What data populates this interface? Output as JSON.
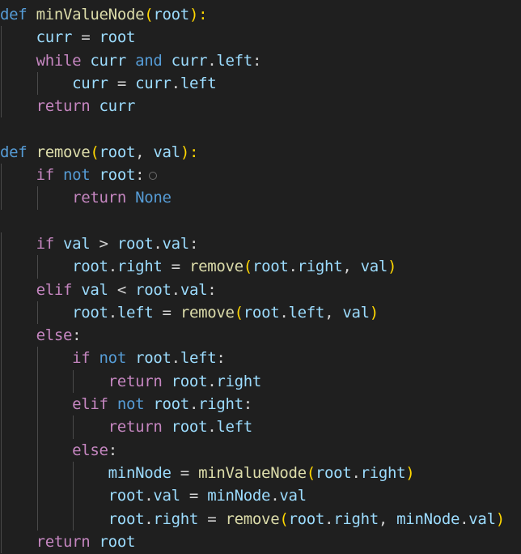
{
  "editor": {
    "language": "python",
    "theme": {
      "background": "#1f1f1f"
    },
    "lines": [
      [
        {
          "t": "def",
          "c": "kw"
        },
        {
          "t": " ",
          "c": "op"
        },
        {
          "t": "minValueNode",
          "c": "fn"
        },
        {
          "t": "(",
          "c": "paren"
        },
        {
          "t": "root",
          "c": "var"
        },
        {
          "t": "):",
          "c": "paren"
        }
      ],
      [
        {
          "t": "    "
        },
        {
          "t": "curr",
          "c": "var"
        },
        {
          "t": " = ",
          "c": "op"
        },
        {
          "t": "root",
          "c": "var"
        }
      ],
      [
        {
          "t": "    "
        },
        {
          "t": "while",
          "c": "ctl"
        },
        {
          "t": " ",
          "c": "op"
        },
        {
          "t": "curr",
          "c": "var"
        },
        {
          "t": " ",
          "c": "op"
        },
        {
          "t": "and",
          "c": "kw"
        },
        {
          "t": " ",
          "c": "op"
        },
        {
          "t": "curr",
          "c": "var"
        },
        {
          "t": ".",
          "c": "op"
        },
        {
          "t": "left",
          "c": "var"
        },
        {
          "t": ":",
          "c": "op"
        }
      ],
      [
        {
          "t": "        "
        },
        {
          "t": "curr",
          "c": "var"
        },
        {
          "t": " = ",
          "c": "op"
        },
        {
          "t": "curr",
          "c": "var"
        },
        {
          "t": ".",
          "c": "op"
        },
        {
          "t": "left",
          "c": "var"
        }
      ],
      [
        {
          "t": "    "
        },
        {
          "t": "return",
          "c": "ctl"
        },
        {
          "t": " ",
          "c": "op"
        },
        {
          "t": "curr",
          "c": "var"
        }
      ],
      [],
      [
        {
          "t": "def",
          "c": "kw"
        },
        {
          "t": " ",
          "c": "op"
        },
        {
          "t": "remove",
          "c": "fn"
        },
        {
          "t": "(",
          "c": "paren"
        },
        {
          "t": "root",
          "c": "var"
        },
        {
          "t": ", ",
          "c": "op"
        },
        {
          "t": "val",
          "c": "var"
        },
        {
          "t": "):",
          "c": "paren"
        }
      ],
      [
        {
          "t": "    "
        },
        {
          "t": "if",
          "c": "ctl"
        },
        {
          "t": " ",
          "c": "op"
        },
        {
          "t": "not",
          "c": "kw"
        },
        {
          "t": " ",
          "c": "op"
        },
        {
          "t": "root",
          "c": "var"
        },
        {
          "t": ":",
          "c": "op"
        },
        {
          "hint": "inlay-hint-dot"
        }
      ],
      [
        {
          "t": "        "
        },
        {
          "t": "return",
          "c": "ctl"
        },
        {
          "t": " ",
          "c": "op"
        },
        {
          "t": "None",
          "c": "const"
        }
      ],
      [],
      [
        {
          "t": "    "
        },
        {
          "t": "if",
          "c": "ctl"
        },
        {
          "t": " ",
          "c": "op"
        },
        {
          "t": "val",
          "c": "var"
        },
        {
          "t": " > ",
          "c": "op"
        },
        {
          "t": "root",
          "c": "var"
        },
        {
          "t": ".",
          "c": "op"
        },
        {
          "t": "val",
          "c": "var"
        },
        {
          "t": ":",
          "c": "op"
        }
      ],
      [
        {
          "t": "        "
        },
        {
          "t": "root",
          "c": "var"
        },
        {
          "t": ".",
          "c": "op"
        },
        {
          "t": "right",
          "c": "var"
        },
        {
          "t": " = ",
          "c": "op"
        },
        {
          "t": "remove",
          "c": "fn"
        },
        {
          "t": "(",
          "c": "paren"
        },
        {
          "t": "root",
          "c": "var"
        },
        {
          "t": ".",
          "c": "op"
        },
        {
          "t": "right",
          "c": "var"
        },
        {
          "t": ", ",
          "c": "op"
        },
        {
          "t": "val",
          "c": "var"
        },
        {
          "t": ")",
          "c": "paren"
        }
      ],
      [
        {
          "t": "    "
        },
        {
          "t": "elif",
          "c": "ctl"
        },
        {
          "t": " ",
          "c": "op"
        },
        {
          "t": "val",
          "c": "var"
        },
        {
          "t": " < ",
          "c": "op"
        },
        {
          "t": "root",
          "c": "var"
        },
        {
          "t": ".",
          "c": "op"
        },
        {
          "t": "val",
          "c": "var"
        },
        {
          "t": ":",
          "c": "op"
        }
      ],
      [
        {
          "t": "        "
        },
        {
          "t": "root",
          "c": "var"
        },
        {
          "t": ".",
          "c": "op"
        },
        {
          "t": "left",
          "c": "var"
        },
        {
          "t": " = ",
          "c": "op"
        },
        {
          "t": "remove",
          "c": "fn"
        },
        {
          "t": "(",
          "c": "paren"
        },
        {
          "t": "root",
          "c": "var"
        },
        {
          "t": ".",
          "c": "op"
        },
        {
          "t": "left",
          "c": "var"
        },
        {
          "t": ", ",
          "c": "op"
        },
        {
          "t": "val",
          "c": "var"
        },
        {
          "t": ")",
          "c": "paren"
        }
      ],
      [
        {
          "t": "    "
        },
        {
          "t": "else",
          "c": "ctl"
        },
        {
          "t": ":",
          "c": "op"
        }
      ],
      [
        {
          "t": "        "
        },
        {
          "t": "if",
          "c": "ctl"
        },
        {
          "t": " ",
          "c": "op"
        },
        {
          "t": "not",
          "c": "kw"
        },
        {
          "t": " ",
          "c": "op"
        },
        {
          "t": "root",
          "c": "var"
        },
        {
          "t": ".",
          "c": "op"
        },
        {
          "t": "left",
          "c": "var"
        },
        {
          "t": ":",
          "c": "op"
        }
      ],
      [
        {
          "t": "            "
        },
        {
          "t": "return",
          "c": "ctl"
        },
        {
          "t": " ",
          "c": "op"
        },
        {
          "t": "root",
          "c": "var"
        },
        {
          "t": ".",
          "c": "op"
        },
        {
          "t": "right",
          "c": "var"
        }
      ],
      [
        {
          "t": "        "
        },
        {
          "t": "elif",
          "c": "ctl"
        },
        {
          "t": " ",
          "c": "op"
        },
        {
          "t": "not",
          "c": "kw"
        },
        {
          "t": " ",
          "c": "op"
        },
        {
          "t": "root",
          "c": "var"
        },
        {
          "t": ".",
          "c": "op"
        },
        {
          "t": "right",
          "c": "var"
        },
        {
          "t": ":",
          "c": "op"
        }
      ],
      [
        {
          "t": "            "
        },
        {
          "t": "return",
          "c": "ctl"
        },
        {
          "t": " ",
          "c": "op"
        },
        {
          "t": "root",
          "c": "var"
        },
        {
          "t": ".",
          "c": "op"
        },
        {
          "t": "left",
          "c": "var"
        }
      ],
      [
        {
          "t": "        "
        },
        {
          "t": "else",
          "c": "ctl"
        },
        {
          "t": ":",
          "c": "op"
        }
      ],
      [
        {
          "t": "            "
        },
        {
          "t": "minNode",
          "c": "var"
        },
        {
          "t": " = ",
          "c": "op"
        },
        {
          "t": "minValueNode",
          "c": "fn"
        },
        {
          "t": "(",
          "c": "paren"
        },
        {
          "t": "root",
          "c": "var"
        },
        {
          "t": ".",
          "c": "op"
        },
        {
          "t": "right",
          "c": "var"
        },
        {
          "t": ")",
          "c": "paren"
        }
      ],
      [
        {
          "t": "            "
        },
        {
          "t": "root",
          "c": "var"
        },
        {
          "t": ".",
          "c": "op"
        },
        {
          "t": "val",
          "c": "var"
        },
        {
          "t": " = ",
          "c": "op"
        },
        {
          "t": "minNode",
          "c": "var"
        },
        {
          "t": ".",
          "c": "op"
        },
        {
          "t": "val",
          "c": "var"
        }
      ],
      [
        {
          "t": "            "
        },
        {
          "t": "root",
          "c": "var"
        },
        {
          "t": ".",
          "c": "op"
        },
        {
          "t": "right",
          "c": "var"
        },
        {
          "t": " = ",
          "c": "op"
        },
        {
          "t": "remove",
          "c": "fn"
        },
        {
          "t": "(",
          "c": "paren"
        },
        {
          "t": "root",
          "c": "var"
        },
        {
          "t": ".",
          "c": "op"
        },
        {
          "t": "right",
          "c": "var"
        },
        {
          "t": ", ",
          "c": "op"
        },
        {
          "t": "minNode",
          "c": "var"
        },
        {
          "t": ".",
          "c": "op"
        },
        {
          "t": "val",
          "c": "var"
        },
        {
          "t": ")",
          "c": "paren"
        }
      ],
      [
        {
          "t": "    "
        },
        {
          "t": "return",
          "c": "ctl"
        },
        {
          "t": " ",
          "c": "op"
        },
        {
          "t": "root",
          "c": "var"
        }
      ]
    ]
  }
}
